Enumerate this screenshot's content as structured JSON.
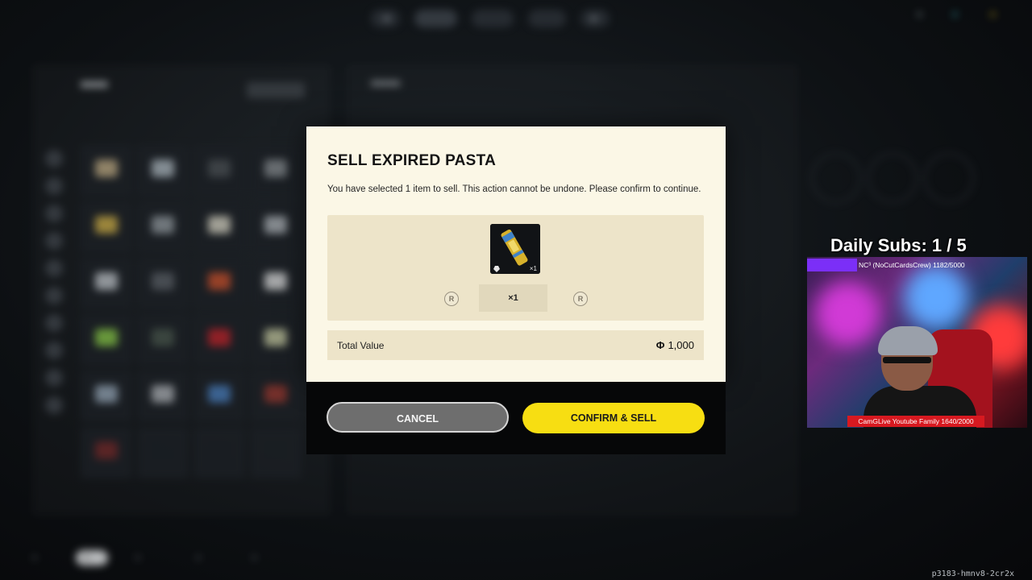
{
  "modal": {
    "title": "SELL EXPIRED PASTA",
    "description": "You have selected 1 item to sell. This action cannot be undone. Please confirm to continue.",
    "item": {
      "icon": "pasta-item-icon",
      "qty_badge": "×1"
    },
    "stepper": {
      "left_key": "R",
      "right_key": "R",
      "value": "×1"
    },
    "total": {
      "label": "Total Value",
      "currency_symbol": "Φ",
      "value": "1,000"
    },
    "buttons": {
      "cancel": "CANCEL",
      "confirm": "CONFIRM & SELL"
    },
    "colors": {
      "panel": "#fbf7e6",
      "confirm": "#f7de12",
      "cancel": "#6e6e6e"
    }
  },
  "overlay": {
    "subs_goal": "Daily Subs: 1 / 5",
    "cam_top_label": "NC³ (NoCutCardsCrew) 1182/5000",
    "cam_bottom_label": "CamGLive Youtube Family 1640/2000"
  },
  "session_id": "p3183-hmnv8-2cr2x"
}
